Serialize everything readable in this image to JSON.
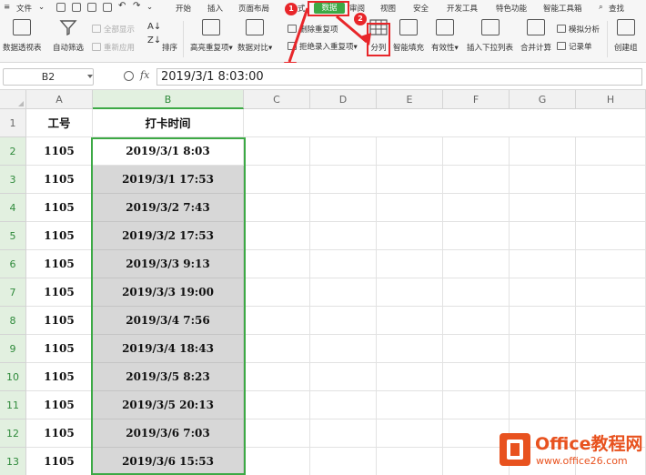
{
  "menubar": {
    "file_label": "文件",
    "tabs": [
      "开始",
      "插入",
      "页面布局",
      "式",
      "数据",
      "审阅",
      "视图",
      "安全",
      "开发工具",
      "特色功能",
      "智能工具箱"
    ],
    "search_label": "查找"
  },
  "ribbon": {
    "pivot_table": "数据透视表",
    "auto_filter": "自动筛选",
    "show_all": "全部显示",
    "reapply": "重新应用",
    "sort": "排序",
    "highlight_dup": "高亮重复项",
    "data_compare": "数据对比",
    "remove_dup": "删除重复项",
    "reject_dup": "拒绝录入重复项",
    "split_column": "分列",
    "smart_fill": "智能填充",
    "validity": "有效性",
    "dropdown_list": "插入下拉列表",
    "consolidate": "合并计算",
    "simulation": "模拟分析",
    "record_sheet": "记录单",
    "create_group": "创建组"
  },
  "annotations": {
    "step1": "1",
    "step2": "2"
  },
  "formula_bar": {
    "cell_ref": "B2",
    "fx": "fx",
    "value": "2019/3/1 8:03:00"
  },
  "grid": {
    "columns": [
      "A",
      "B",
      "C",
      "D",
      "E",
      "F",
      "G",
      "H"
    ],
    "header_row": {
      "row": "1",
      "a": "工号",
      "b": "打卡时间"
    },
    "rows": [
      {
        "row": "2",
        "id": "1105",
        "time": "2019/3/1 8:03"
      },
      {
        "row": "3",
        "id": "1105",
        "time": "2019/3/1 17:53"
      },
      {
        "row": "4",
        "id": "1105",
        "time": "2019/3/2 7:43"
      },
      {
        "row": "5",
        "id": "1105",
        "time": "2019/3/2 17:53"
      },
      {
        "row": "6",
        "id": "1105",
        "time": "2019/3/3 9:13"
      },
      {
        "row": "7",
        "id": "1105",
        "time": "2019/3/3 19:00"
      },
      {
        "row": "8",
        "id": "1105",
        "time": "2019/3/4 7:56"
      },
      {
        "row": "9",
        "id": "1105",
        "time": "2019/3/4 18:43"
      },
      {
        "row": "10",
        "id": "1105",
        "time": "2019/3/5 8:23"
      },
      {
        "row": "11",
        "id": "1105",
        "time": "2019/3/5 20:13"
      },
      {
        "row": "12",
        "id": "1105",
        "time": "2019/3/6 7:03"
      },
      {
        "row": "13",
        "id": "1105",
        "time": "2019/3/6 15:53"
      }
    ]
  },
  "watermark": {
    "title": "Office教程网",
    "url": "www.office26.com"
  },
  "colors": {
    "accent_green": "#3ca945",
    "annotation_red": "#e8262a",
    "brand_orange": "#e8521f"
  }
}
